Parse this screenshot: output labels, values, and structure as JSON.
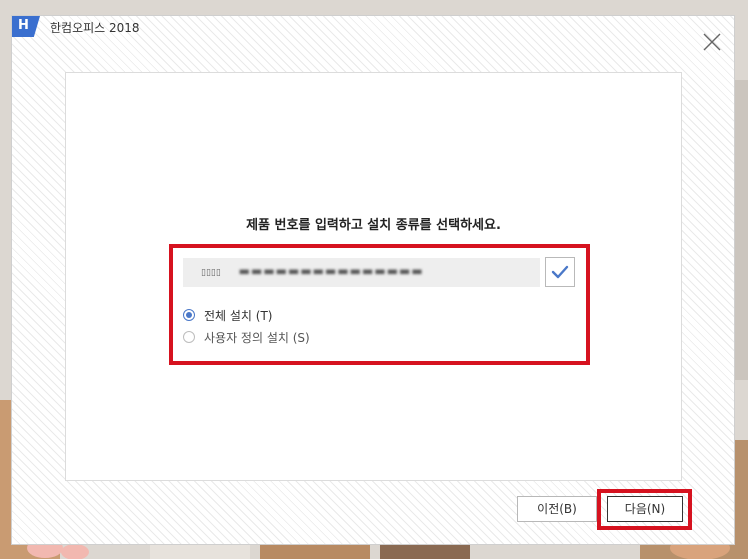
{
  "window": {
    "logo_letter": "H",
    "title": "한컴오피스 2018"
  },
  "main": {
    "heading": "제품 번호를 입력하고 설치 종류를 선택하세요.",
    "product_key": {
      "prefix": "▯▯▯▯",
      "value": "▬▬▬▬▬▬▬▬▬▬▬▬▬▬▬"
    },
    "install_options": [
      {
        "label": "전체 설치 (T)",
        "selected": true
      },
      {
        "label": "사용자 정의 설치 (S)",
        "selected": false
      }
    ]
  },
  "footer": {
    "prev_label": "이전(B)",
    "next_label": "다음(N)"
  },
  "colors": {
    "accent": "#4a78c8",
    "highlight": "#d6121f",
    "logo": "#3a6fcf"
  }
}
